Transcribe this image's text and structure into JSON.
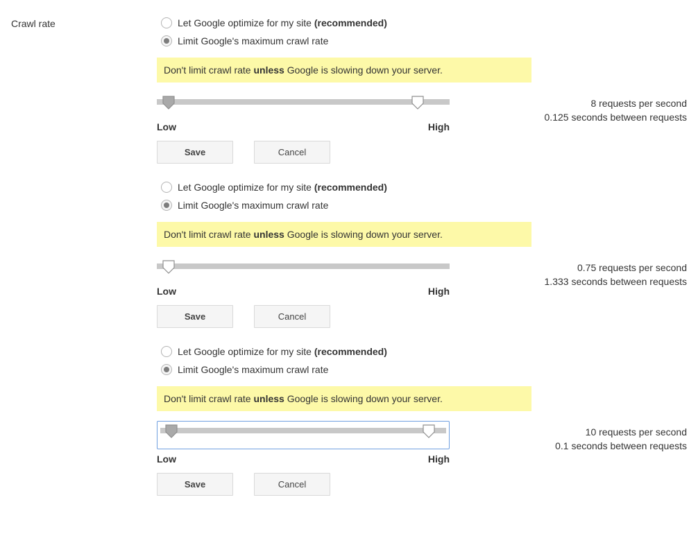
{
  "section_label": "Crawl rate",
  "radio": {
    "optimize_prefix": "Let Google optimize for my site ",
    "optimize_suffix": "(recommended)",
    "limit": "Limit Google's maximum crawl rate"
  },
  "notice": {
    "prefix": "Don't limit crawl rate ",
    "bold": "unless",
    "suffix": " Google is slowing down your server."
  },
  "slider": {
    "low": "Low",
    "high": "High"
  },
  "buttons": {
    "save": "Save",
    "cancel": "Cancel"
  },
  "blocks": [
    {
      "low_pct": 4,
      "high_pct": 89,
      "focused": false,
      "rate_line1": "8 requests per second",
      "rate_line2": "0.125 seconds between requests"
    },
    {
      "low_pct": 4,
      "high_pct": null,
      "focused": false,
      "rate_line1": "0.75 requests per second",
      "rate_line2": "1.333 seconds between requests"
    },
    {
      "low_pct": 4,
      "high_pct": 94,
      "focused": true,
      "rate_line1": "10 requests per second",
      "rate_line2": "0.1 seconds between requests"
    }
  ]
}
